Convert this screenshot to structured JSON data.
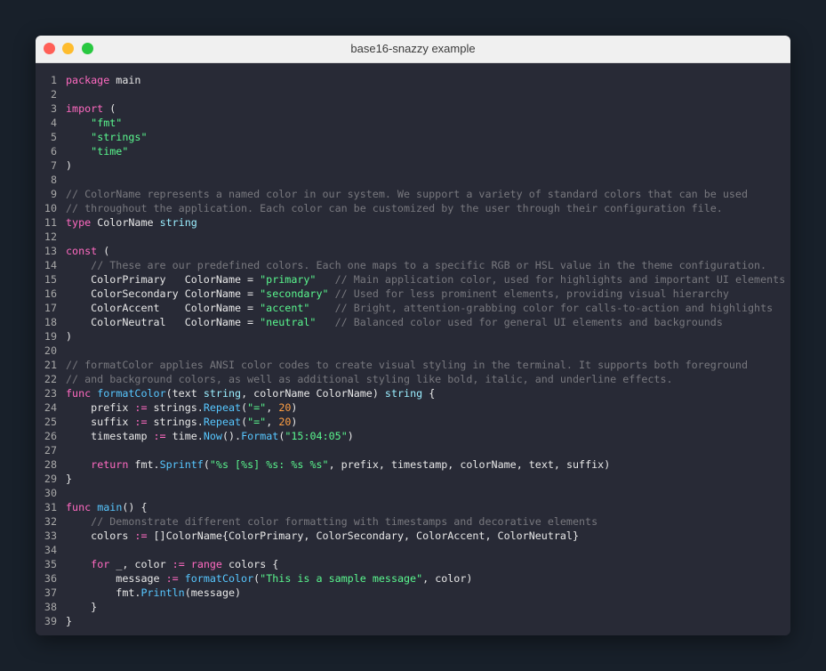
{
  "window": {
    "title": "base16-snazzy example"
  },
  "colors": {
    "background": "#282a36",
    "keyword": "#ff6ac1",
    "string": "#5af78e",
    "comment": "#78787e",
    "function": "#57c7ff",
    "type": "#9aedfe",
    "number": "#ff9f43"
  },
  "code": {
    "lines": [
      [
        [
          "kw",
          "package"
        ],
        [
          "t",
          " main"
        ]
      ],
      [],
      [
        [
          "kw",
          "import"
        ],
        [
          "t",
          " ("
        ]
      ],
      [
        [
          "t",
          "    "
        ],
        [
          "str",
          "\"fmt\""
        ]
      ],
      [
        [
          "t",
          "    "
        ],
        [
          "str",
          "\"strings\""
        ]
      ],
      [
        [
          "t",
          "    "
        ],
        [
          "str",
          "\"time\""
        ]
      ],
      [
        [
          "t",
          ")"
        ]
      ],
      [],
      [
        [
          "cm",
          "// ColorName represents a named color in our system. We support a variety of standard colors that can be used"
        ]
      ],
      [
        [
          "cm",
          "// throughout the application. Each color can be customized by the user through their configuration file."
        ]
      ],
      [
        [
          "kw",
          "type"
        ],
        [
          "t",
          " ColorName "
        ],
        [
          "ty",
          "string"
        ]
      ],
      [],
      [
        [
          "kw",
          "const"
        ],
        [
          "t",
          " ("
        ]
      ],
      [
        [
          "t",
          "    "
        ],
        [
          "cm",
          "// These are our predefined colors. Each one maps to a specific RGB or HSL value in the theme configuration."
        ]
      ],
      [
        [
          "t",
          "    ColorPrimary   ColorName = "
        ],
        [
          "str",
          "\"primary\""
        ],
        [
          "t",
          "   "
        ],
        [
          "cm",
          "// Main application color, used for highlights and important UI elements"
        ]
      ],
      [
        [
          "t",
          "    ColorSecondary ColorName = "
        ],
        [
          "str",
          "\"secondary\""
        ],
        [
          "t",
          " "
        ],
        [
          "cm",
          "// Used for less prominent elements, providing visual hierarchy"
        ]
      ],
      [
        [
          "t",
          "    ColorAccent    ColorName = "
        ],
        [
          "str",
          "\"accent\""
        ],
        [
          "t",
          "    "
        ],
        [
          "cm",
          "// Bright, attention-grabbing color for calls-to-action and highlights"
        ]
      ],
      [
        [
          "t",
          "    ColorNeutral   ColorName = "
        ],
        [
          "str",
          "\"neutral\""
        ],
        [
          "t",
          "   "
        ],
        [
          "cm",
          "// Balanced color used for general UI elements and backgrounds"
        ]
      ],
      [
        [
          "t",
          ")"
        ]
      ],
      [],
      [
        [
          "cm",
          "// formatColor applies ANSI color codes to create visual styling in the terminal. It supports both foreground"
        ]
      ],
      [
        [
          "cm",
          "// and background colors, as well as additional styling like bold, italic, and underline effects."
        ]
      ],
      [
        [
          "kw",
          "func"
        ],
        [
          "t",
          " "
        ],
        [
          "fn",
          "formatColor"
        ],
        [
          "t",
          "(text "
        ],
        [
          "ty",
          "string"
        ],
        [
          "t",
          ", colorName ColorName) "
        ],
        [
          "ty",
          "string"
        ],
        [
          "t",
          " {"
        ]
      ],
      [
        [
          "t",
          "    prefix "
        ],
        [
          "op",
          ":="
        ],
        [
          "t",
          " strings."
        ],
        [
          "fn",
          "Repeat"
        ],
        [
          "t",
          "("
        ],
        [
          "str",
          "\"=\""
        ],
        [
          "t",
          ", "
        ],
        [
          "num",
          "20"
        ],
        [
          "t",
          ")"
        ]
      ],
      [
        [
          "t",
          "    suffix "
        ],
        [
          "op",
          ":="
        ],
        [
          "t",
          " strings."
        ],
        [
          "fn",
          "Repeat"
        ],
        [
          "t",
          "("
        ],
        [
          "str",
          "\"=\""
        ],
        [
          "t",
          ", "
        ],
        [
          "num",
          "20"
        ],
        [
          "t",
          ")"
        ]
      ],
      [
        [
          "t",
          "    timestamp "
        ],
        [
          "op",
          ":="
        ],
        [
          "t",
          " time."
        ],
        [
          "fn",
          "Now"
        ],
        [
          "t",
          "()."
        ],
        [
          "fn",
          "Format"
        ],
        [
          "t",
          "("
        ],
        [
          "str",
          "\"15:04:05\""
        ],
        [
          "t",
          ")"
        ]
      ],
      [],
      [
        [
          "t",
          "    "
        ],
        [
          "kw",
          "return"
        ],
        [
          "t",
          " fmt."
        ],
        [
          "fn",
          "Sprintf"
        ],
        [
          "t",
          "("
        ],
        [
          "str",
          "\"%s [%s] %s: %s %s\""
        ],
        [
          "t",
          ", prefix, timestamp, colorName, text, suffix)"
        ]
      ],
      [
        [
          "t",
          "}"
        ]
      ],
      [],
      [
        [
          "kw",
          "func"
        ],
        [
          "t",
          " "
        ],
        [
          "fn",
          "main"
        ],
        [
          "t",
          "() {"
        ]
      ],
      [
        [
          "t",
          "    "
        ],
        [
          "cm",
          "// Demonstrate different color formatting with timestamps and decorative elements"
        ]
      ],
      [
        [
          "t",
          "    colors "
        ],
        [
          "op",
          ":="
        ],
        [
          "t",
          " []ColorName{ColorPrimary, ColorSecondary, ColorAccent, ColorNeutral}"
        ]
      ],
      [],
      [
        [
          "t",
          "    "
        ],
        [
          "kw",
          "for"
        ],
        [
          "t",
          " _, color "
        ],
        [
          "op",
          ":="
        ],
        [
          "t",
          " "
        ],
        [
          "kw",
          "range"
        ],
        [
          "t",
          " colors {"
        ]
      ],
      [
        [
          "t",
          "        message "
        ],
        [
          "op",
          ":="
        ],
        [
          "t",
          " "
        ],
        [
          "fn",
          "formatColor"
        ],
        [
          "t",
          "("
        ],
        [
          "str",
          "\"This is a sample message\""
        ],
        [
          "t",
          ", color)"
        ]
      ],
      [
        [
          "t",
          "        fmt."
        ],
        [
          "fn",
          "Println"
        ],
        [
          "t",
          "(message)"
        ]
      ],
      [
        [
          "t",
          "    }"
        ]
      ],
      [
        [
          "t",
          "}"
        ]
      ]
    ]
  }
}
